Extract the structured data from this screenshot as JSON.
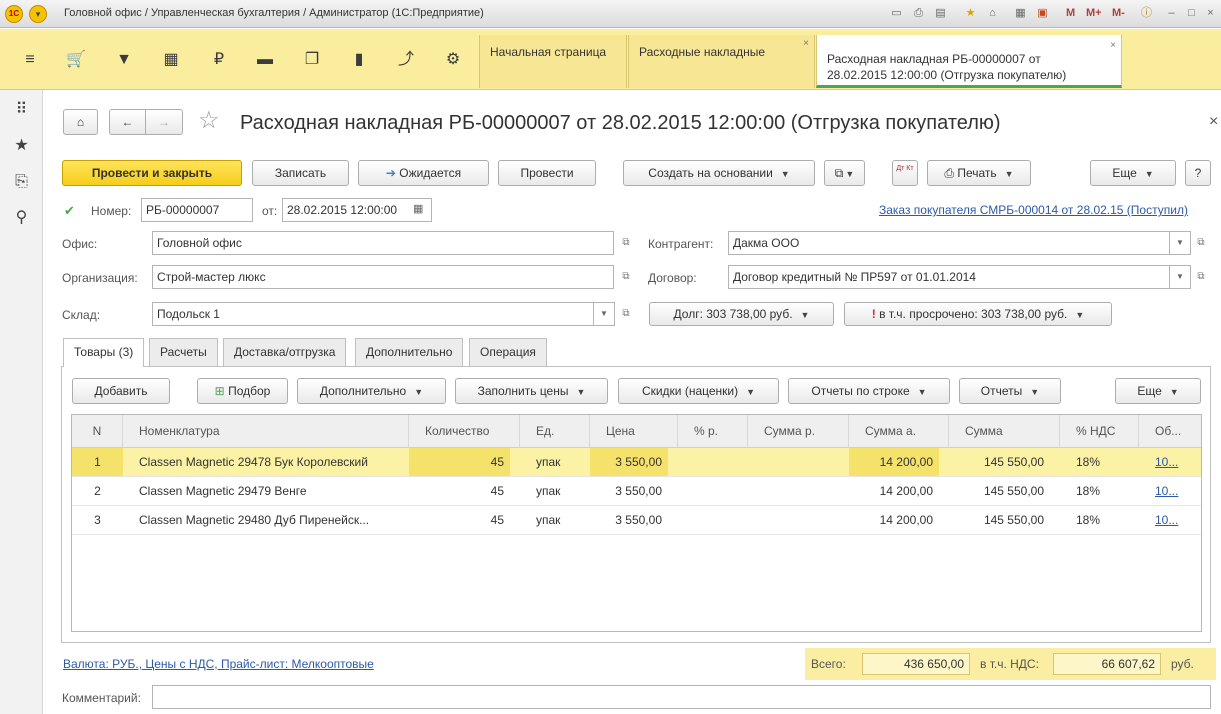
{
  "window": {
    "logo": "1С",
    "title": "Головной офис / Управленческая бухгалтерия / Администратор (1С:Предприятие)",
    "m": "M",
    "m_plus": "M+",
    "m_minus": "M-"
  },
  "sections": {
    "icons": [
      "menu-icon",
      "cart-icon",
      "bag-icon",
      "grid-icon",
      "ruble-icon",
      "truck-icon",
      "documents-icon",
      "bar-chart-icon",
      "trend-icon",
      "gear-icon"
    ]
  },
  "tabs": [
    {
      "label": "Начальная страница"
    },
    {
      "label": "Расходные накладные",
      "close": "×"
    },
    {
      "label_line1": "Расходная накладная РБ-00000007 от",
      "label_line2": "28.02.2015 12:00:00 (Отгрузка покупателю)",
      "close": "×"
    }
  ],
  "left_icons": [
    "apps-icon",
    "star-icon",
    "history-icon",
    "search-icon"
  ],
  "document": {
    "title": "Расходная накладная РБ-00000007 от 28.02.2015 12:00:00 (Отгрузка покупателю)",
    "close": "×"
  },
  "toolbar": {
    "post_close": "Провести и закрыть",
    "save": "Записать",
    "expected": "Ожидается",
    "post": "Провести",
    "create_based": "Создать на основании",
    "print": "Печать",
    "more": "Еще",
    "help": "?",
    "dt_kt": "Дт Кт"
  },
  "header": {
    "number_label": "Номер:",
    "number": "РБ-00000007",
    "date_label": "от:",
    "date": "28.02.2015 12:00:00",
    "order_link": "Заказ покупателя СМРБ-000014 от 28.02.15 (Поступил)"
  },
  "fields": {
    "office_label": "Офис:",
    "office": "Головной офис",
    "org_label": "Организация:",
    "org": "Строй-мастер люкс",
    "warehouse_label": "Склад:",
    "warehouse": "Подольск 1",
    "contractor_label": "Контрагент:",
    "contractor": "Дакма ООО",
    "contract_label": "Договор:",
    "contract": "Договор кредитный № ПР597 от 01.01.2014",
    "debt": "Долг: 303 738,00 руб.",
    "overdue": "в т.ч. просрочено: 303 738,00 руб."
  },
  "form_tabs": [
    "Товары (3)",
    "Расчеты",
    "Доставка/отгрузка",
    "Дополнительно",
    "Операция"
  ],
  "table_toolbar": {
    "add": "Добавить",
    "pick": "Подбор",
    "extra": "Дополнительно",
    "fill_prices": "Заполнить цены",
    "discounts": "Скидки (наценки)",
    "row_reports": "Отчеты по строке",
    "reports": "Отчеты",
    "more": "Еще"
  },
  "table": {
    "columns": [
      "N",
      "Номенклатура",
      "Количество",
      "Ед.",
      "Цена",
      "% р.",
      "Сумма р.",
      "Сумма а.",
      "Сумма",
      "% НДС",
      "Об..."
    ],
    "rows": [
      {
        "n": "1",
        "item": "Classen Magnetic 29478 Бук Королевский",
        "qty": "45",
        "unit": "упак",
        "price": "3 550,00",
        "pct_r": "",
        "sum_r": "",
        "sum_a": "14 200,00",
        "sum": "145 550,00",
        "vat": "18%",
        "ob": "10..."
      },
      {
        "n": "2",
        "item": "Classen Magnetic 29479 Венге",
        "qty": "45",
        "unit": "упак",
        "price": "3 550,00",
        "pct_r": "",
        "sum_r": "",
        "sum_a": "14 200,00",
        "sum": "145 550,00",
        "vat": "18%",
        "ob": "10..."
      },
      {
        "n": "3",
        "item": "Classen Magnetic 29480 Дуб Пиренейск...",
        "qty": "45",
        "unit": "упак",
        "price": "3 550,00",
        "pct_r": "",
        "sum_r": "",
        "sum_a": "14 200,00",
        "sum": "145 550,00",
        "vat": "18%",
        "ob": "10..."
      }
    ]
  },
  "footer": {
    "currency_link": "Валюта: РУБ., Цены с НДС, Прайс-лист: Мелкооптовые",
    "total_label": "Всего:",
    "total": "436 650,00",
    "vat_label": "в т.ч. НДС:",
    "vat": "66 607,62",
    "currency": "руб.",
    "comment_label": "Комментарий:",
    "comment": ""
  },
  "colors": {
    "accent_yellow": "#f5cd18",
    "section_bar": "#fbed9e",
    "active_tab_line": "#4ba553",
    "link": "#2b5aa8",
    "selected_row": "#fcf2a6"
  }
}
